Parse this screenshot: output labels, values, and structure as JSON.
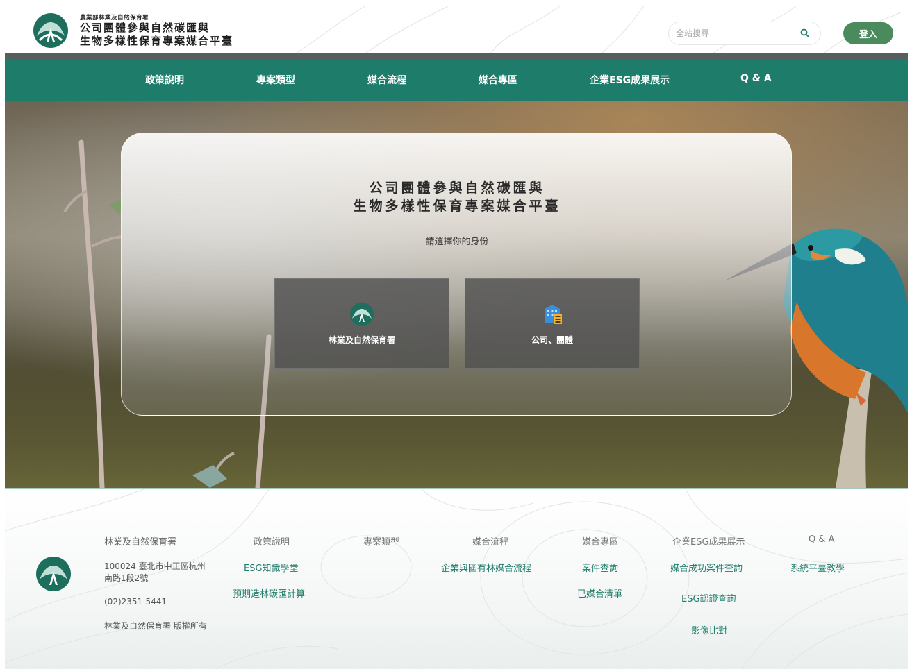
{
  "header": {
    "agency": "農業部林業及自然保育署",
    "title_line1": "公司團體參與自然碳匯與",
    "title_line2": "生物多樣性保育專案媒合平臺",
    "search_placeholder": "全站搜尋",
    "login_label": "登入"
  },
  "nav": {
    "items": [
      {
        "label": "政策說明"
      },
      {
        "label": "專案類型"
      },
      {
        "label": "媒合流程"
      },
      {
        "label": "媒合專區"
      },
      {
        "label": "企業ESG成果展示"
      },
      {
        "label": "Q & A"
      }
    ]
  },
  "hero": {
    "title_line1": "公司團體參與自然碳匯與",
    "title_line2": "生物多樣性保育專案媒合平臺",
    "prompt": "請選擇你的身份",
    "roles": [
      {
        "label": "林業及自然保育署",
        "icon": "agency-logo-icon"
      },
      {
        "label": "公司、團體",
        "icon": "building-icon"
      }
    ]
  },
  "footer": {
    "org_name": "林業及自然保育署",
    "address": "100024 臺北市中正區杭州南路1段2號",
    "address_line1": "100024 臺北市中正區杭州",
    "address_line2": "南路1段2號",
    "phone": "(02)2351-5441",
    "copyright": "林業及自然保育署 版權所有",
    "columns": [
      {
        "heading": "政策說明",
        "links": [
          "ESG知識學堂",
          "預期造林碳匯計算"
        ]
      },
      {
        "heading": "專案類型",
        "links": []
      },
      {
        "heading": "媒合流程",
        "links": [
          "企業與國有林媒合流程"
        ]
      },
      {
        "heading": "媒合專區",
        "links": [
          "案件查詢",
          "已媒合清單"
        ]
      },
      {
        "heading": "企業ESG成果展示",
        "links": [
          "媒合成功案件查詢",
          "ESG認證查詢",
          "影像比對"
        ]
      },
      {
        "heading": "Q & A",
        "links": [
          "系統平臺教學"
        ]
      }
    ]
  },
  "colors": {
    "primary_green": "#1e7c6a",
    "login_green": "#4a8a5c",
    "bar_gray": "#55605e"
  }
}
